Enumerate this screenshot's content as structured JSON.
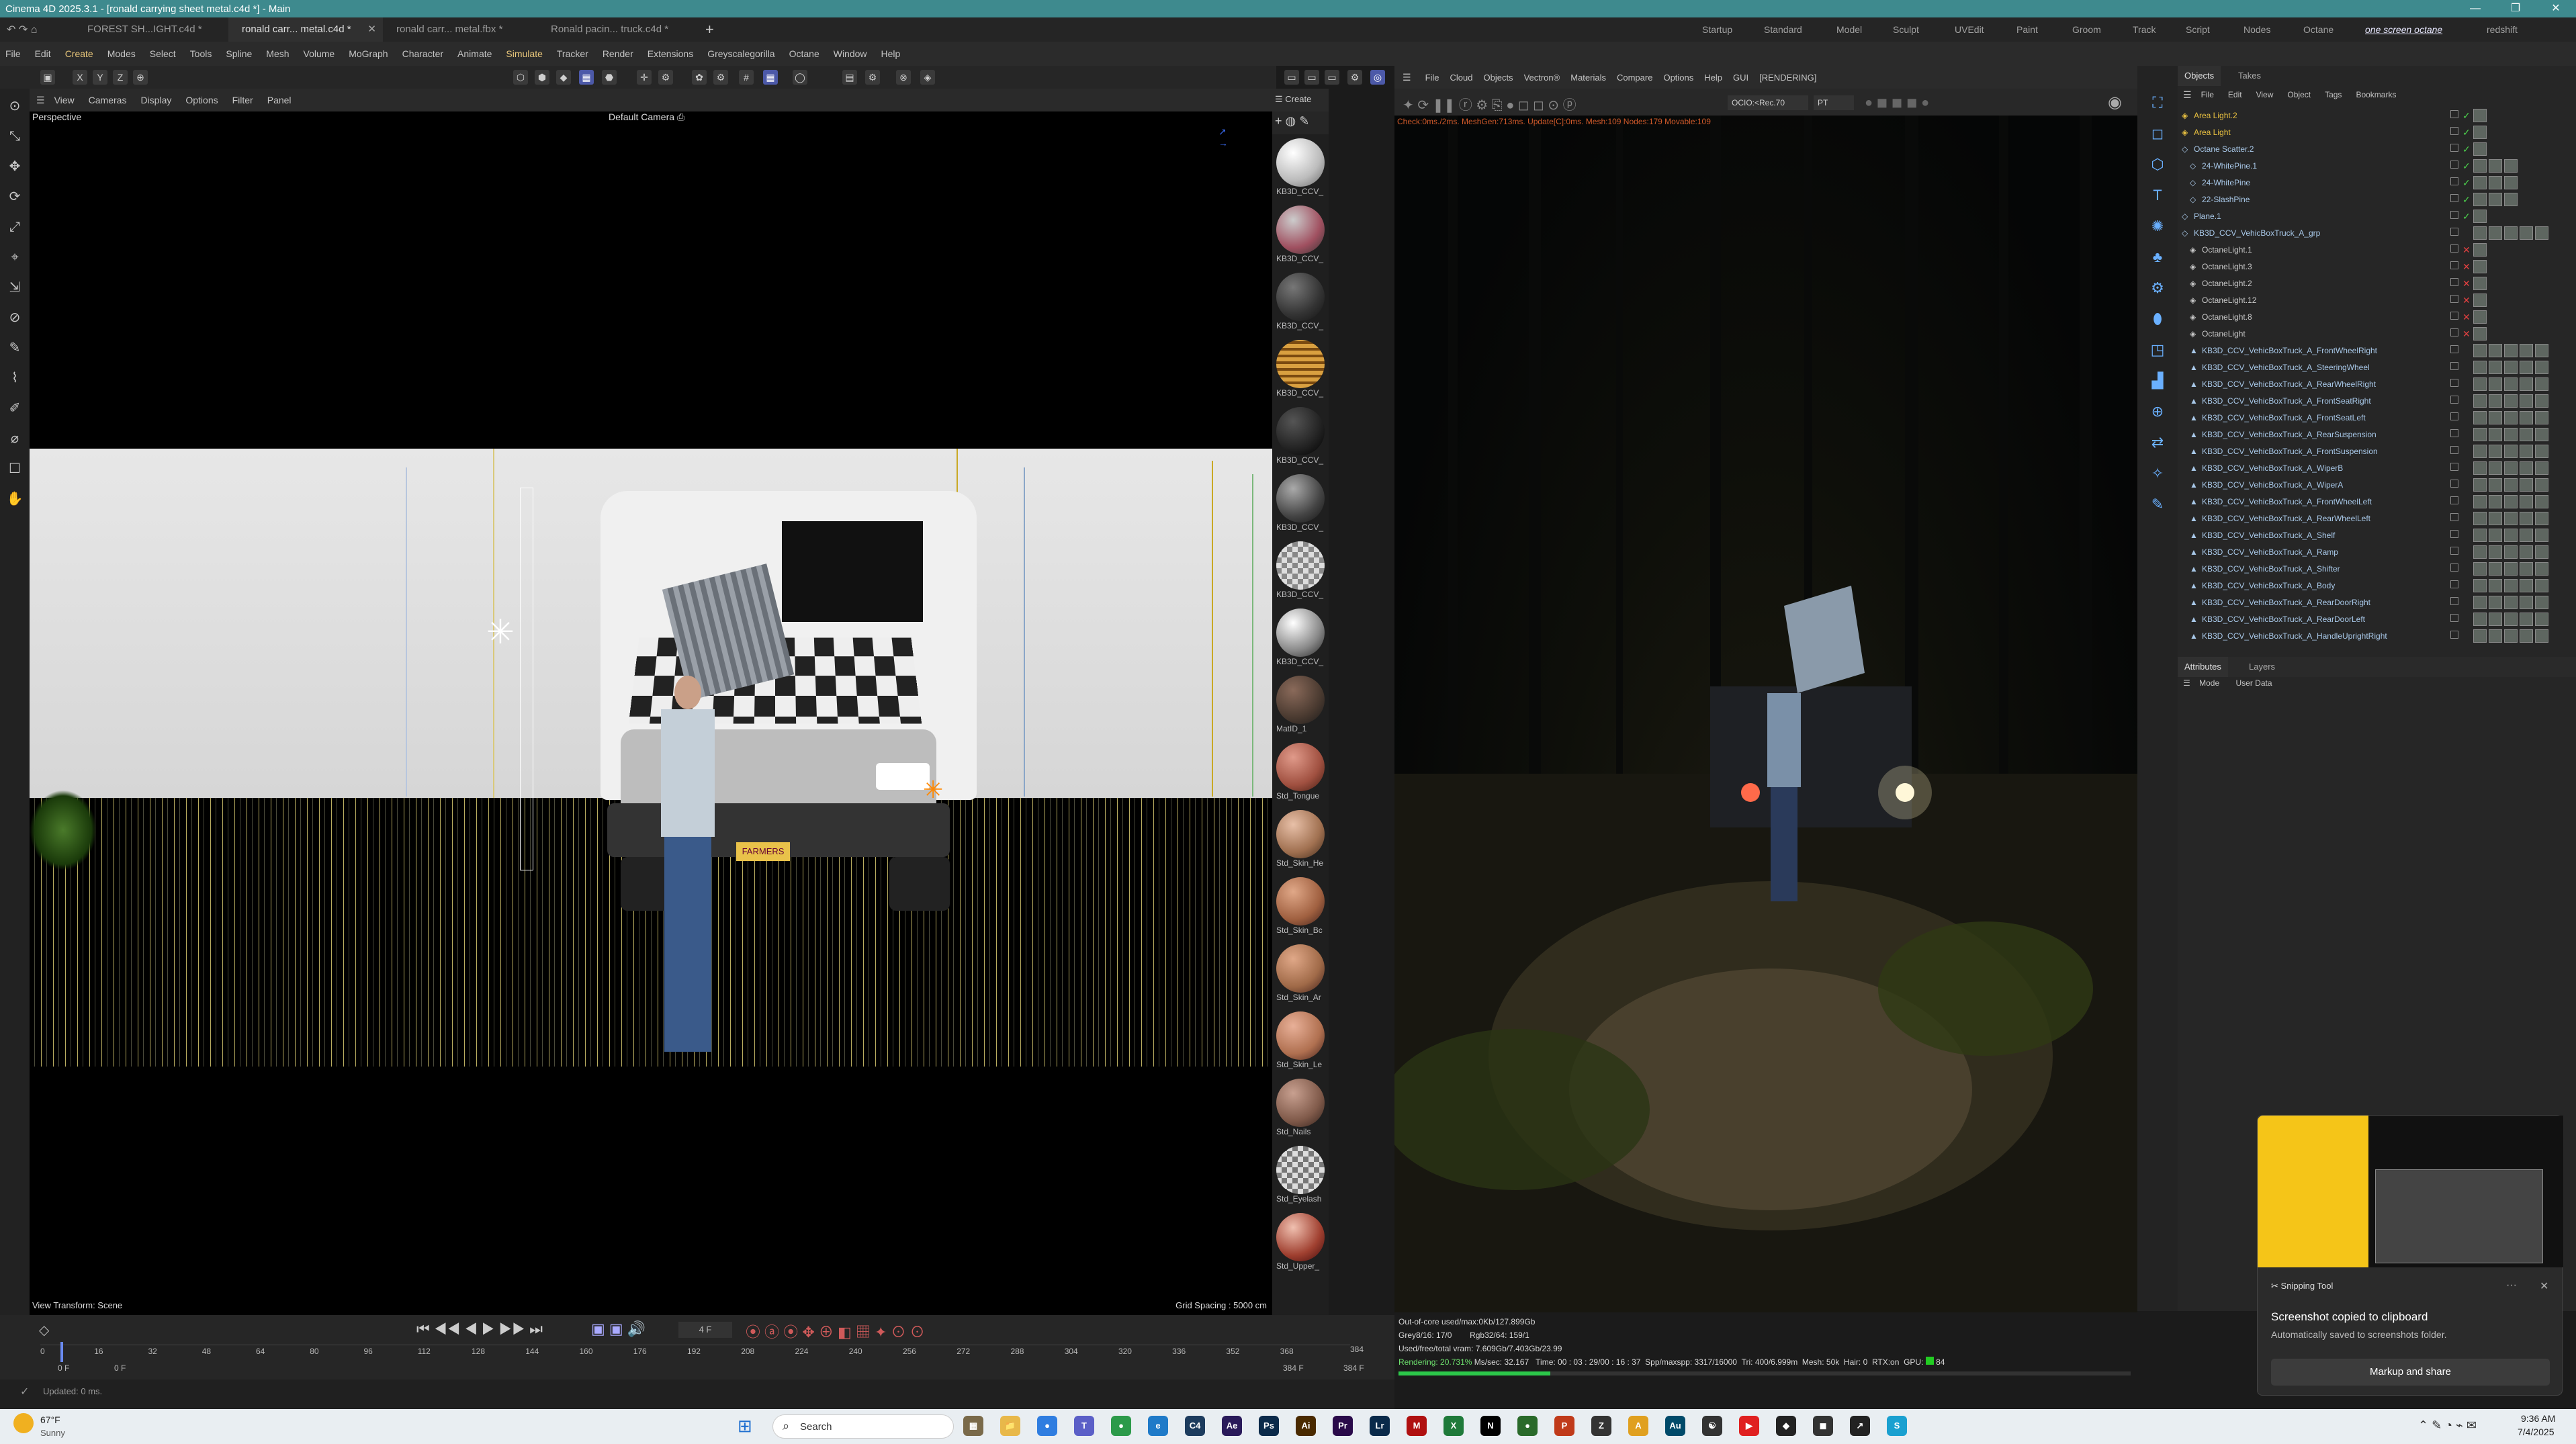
{
  "app_title": "Cinema 4D 2025.3.1 - [ronald carrying sheet metal.c4d *] - Main",
  "window_controls": [
    "—",
    "❐",
    "✕"
  ],
  "file_tabs": [
    {
      "label": "FOREST SH...IGHT.c4d *",
      "active": false
    },
    {
      "label": "ronald carr... metal.c4d *",
      "active": true
    },
    {
      "label": "ronald carr... metal.fbx *",
      "active": false
    },
    {
      "label": "Ronald pacin... truck.c4d *",
      "active": false
    }
  ],
  "add_tab": "+",
  "layouts": [
    "Startup",
    "Standard",
    "Model",
    "Sculpt",
    "UVEdit",
    "Paint",
    "Groom",
    "Track",
    "Script",
    "Nodes",
    "Octane",
    "one screen octane",
    "redshift"
  ],
  "active_layout": "one screen octane",
  "menu": [
    "File",
    "Edit",
    "Create",
    "Modes",
    "Select",
    "Tools",
    "Spline",
    "Mesh",
    "Volume",
    "MoGraph",
    "Character",
    "Animate",
    "Simulate",
    "Tracker",
    "Render",
    "Extensions",
    "Greyscalegorilla",
    "Octane",
    "Window",
    "Help"
  ],
  "active_menu": [
    "Create",
    "Simulate"
  ],
  "viewport": {
    "menu": [
      "View",
      "Cameras",
      "Display",
      "Options",
      "Filter",
      "Panel"
    ],
    "name": "Perspective",
    "camera": "Default Camera",
    "view_transform": "View Transform: Scene",
    "grid_spacing": "Grid Spacing : 5000 cm",
    "plate_text": "FARMERS"
  },
  "materials": {
    "create_label": "Create",
    "items": [
      "KB3D_CCV_",
      "KB3D_CCV_",
      "KB3D_CCV_",
      "KB3D_CCV_",
      "KB3D_CCV_",
      "KB3D_CCV_",
      "KB3D_CCV_",
      "KB3D_CCV_",
      "MatID_1",
      "Std_Tongue",
      "Std_Skin_He",
      "Std_Skin_Bc",
      "Std_Skin_Ar",
      "Std_Skin_Le",
      "Std_Nails",
      "Std_Eyelash",
      "Std_Upper_"
    ]
  },
  "render_view": {
    "menu": [
      "File",
      "Cloud",
      "Objects",
      "Vectron®",
      "Materials",
      "Compare",
      "Options",
      "Help",
      "GUI",
      "[RENDERING]"
    ],
    "ocio": "OCIO:<Rec.70",
    "pt": "PT",
    "top_stats": "Check:0ms./2ms. MeshGen:713ms. Update[C]:0ms. Mesh:109 Nodes:179 Movable:109",
    "stats": {
      "out_of_core": "Out-of-core used/max:0Kb/127.899Gb",
      "grey": "Grey8/16: 17/0",
      "rgb": "Rgb32/64: 159/1",
      "vram": "Used/free/total vram: 7.609Gb/7.403Gb/23.99",
      "rendering": "Rendering: 20.731%",
      "ms_sec": "Ms/sec: 32.167",
      "time": "Time: 00 : 03 : 29/00 : 16 : 37",
      "spp": "Spp/maxspp: 3317/16000",
      "tri": "Tri: 400/6.999m",
      "mesh": "Mesh: 50k",
      "hair": "Hair: 0",
      "rtx": "RTX:on",
      "gpu": "GPU:",
      "gpu_val": "84"
    }
  },
  "objects_panel": {
    "tabs": [
      "Objects",
      "Takes"
    ],
    "menu": [
      "File",
      "Edit",
      "View",
      "Object",
      "Tags",
      "Bookmarks"
    ],
    "rows": [
      {
        "name": "Area Light.2",
        "color": "#e8c040",
        "indent": 0,
        "flag": "✓"
      },
      {
        "name": "Area Light",
        "color": "#e8c040",
        "indent": 0,
        "flag": "✓"
      },
      {
        "name": "Octane Scatter.2",
        "color": "#a8c8e8",
        "indent": 0,
        "flag": "✓"
      },
      {
        "name": "24-WhitePine.1",
        "color": "#a8c8e8",
        "indent": 1,
        "flag": "✓"
      },
      {
        "name": "24-WhitePine",
        "color": "#a8c8e8",
        "indent": 1,
        "flag": "✓"
      },
      {
        "name": "22-SlashPine",
        "color": "#a8c8e8",
        "indent": 1,
        "flag": "✓"
      },
      {
        "name": "Plane.1",
        "color": "#a8c8e8",
        "indent": 0,
        "flag": "✓"
      },
      {
        "name": "KB3D_CCV_VehicBoxTruck_A_grp",
        "color": "#a8c8e8",
        "indent": 0,
        "flag": ""
      },
      {
        "name": "OctaneLight.1",
        "color": "#c8c8c8",
        "indent": 1,
        "flag": "✕"
      },
      {
        "name": "OctaneLight.3",
        "color": "#c8c8c8",
        "indent": 1,
        "flag": "✕"
      },
      {
        "name": "OctaneLight.2",
        "color": "#c8c8c8",
        "indent": 1,
        "flag": "✕"
      },
      {
        "name": "OctaneLight.12",
        "color": "#c8c8c8",
        "indent": 1,
        "flag": "✕"
      },
      {
        "name": "OctaneLight.8",
        "color": "#c8c8c8",
        "indent": 1,
        "flag": "✕"
      },
      {
        "name": "OctaneLight",
        "color": "#c8c8c8",
        "indent": 1,
        "flag": "✕"
      },
      {
        "name": "KB3D_CCV_VehicBoxTruck_A_FrontWheelRight",
        "color": "#a8c8e8",
        "indent": 1,
        "flag": ""
      },
      {
        "name": "KB3D_CCV_VehicBoxTruck_A_SteeringWheel",
        "color": "#a8c8e8",
        "indent": 1,
        "flag": ""
      },
      {
        "name": "KB3D_CCV_VehicBoxTruck_A_RearWheelRight",
        "color": "#a8c8e8",
        "indent": 1,
        "flag": ""
      },
      {
        "name": "KB3D_CCV_VehicBoxTruck_A_FrontSeatRight",
        "color": "#a8c8e8",
        "indent": 1,
        "flag": ""
      },
      {
        "name": "KB3D_CCV_VehicBoxTruck_A_FrontSeatLeft",
        "color": "#a8c8e8",
        "indent": 1,
        "flag": ""
      },
      {
        "name": "KB3D_CCV_VehicBoxTruck_A_RearSuspension",
        "color": "#a8c8e8",
        "indent": 1,
        "flag": ""
      },
      {
        "name": "KB3D_CCV_VehicBoxTruck_A_FrontSuspension",
        "color": "#a8c8e8",
        "indent": 1,
        "flag": ""
      },
      {
        "name": "KB3D_CCV_VehicBoxTruck_A_WiperB",
        "color": "#a8c8e8",
        "indent": 1,
        "flag": ""
      },
      {
        "name": "KB3D_CCV_VehicBoxTruck_A_WiperA",
        "color": "#a8c8e8",
        "indent": 1,
        "flag": ""
      },
      {
        "name": "KB3D_CCV_VehicBoxTruck_A_FrontWheelLeft",
        "color": "#a8c8e8",
        "indent": 1,
        "flag": ""
      },
      {
        "name": "KB3D_CCV_VehicBoxTruck_A_RearWheelLeft",
        "color": "#a8c8e8",
        "indent": 1,
        "flag": ""
      },
      {
        "name": "KB3D_CCV_VehicBoxTruck_A_Shelf",
        "color": "#a8c8e8",
        "indent": 1,
        "flag": ""
      },
      {
        "name": "KB3D_CCV_VehicBoxTruck_A_Ramp",
        "color": "#a8c8e8",
        "indent": 1,
        "flag": ""
      },
      {
        "name": "KB3D_CCV_VehicBoxTruck_A_Shifter",
        "color": "#a8c8e8",
        "indent": 1,
        "flag": ""
      },
      {
        "name": "KB3D_CCV_VehicBoxTruck_A_Body",
        "color": "#a8c8e8",
        "indent": 1,
        "flag": ""
      },
      {
        "name": "KB3D_CCV_VehicBoxTruck_A_RearDoorRight",
        "color": "#a8c8e8",
        "indent": 1,
        "flag": ""
      },
      {
        "name": "KB3D_CCV_VehicBoxTruck_A_RearDoorLeft",
        "color": "#a8c8e8",
        "indent": 1,
        "flag": ""
      },
      {
        "name": "KB3D_CCV_VehicBoxTruck_A_HandleUprightRight",
        "color": "#a8c8e8",
        "indent": 1,
        "flag": ""
      }
    ]
  },
  "attributes_panel": {
    "tabs": [
      "Attributes",
      "Layers"
    ],
    "menu": [
      "Mode",
      "User Data"
    ]
  },
  "timeline": {
    "current_frame": "4 F",
    "ticks": [
      "0",
      "16",
      "32",
      "48",
      "64",
      "80",
      "96",
      "112",
      "128",
      "144",
      "160",
      "176",
      "192",
      "208",
      "224",
      "240",
      "256",
      "272",
      "288",
      "304",
      "320",
      "336",
      "352",
      "368"
    ],
    "start_a": "0 F",
    "start_b": "0 F",
    "end_a": "384 F",
    "end_b": "384 F",
    "end_tick": "384"
  },
  "status": {
    "text": "Updated: 0 ms."
  },
  "taskbar": {
    "weather_temp": "67°F",
    "weather_desc": "Sunny",
    "search": "Search",
    "time": "9:36 AM",
    "date": "7/4/2025",
    "apps": [
      {
        "label": "▦",
        "color": "#7a6a4a"
      },
      {
        "label": "📁",
        "color": "#e8b84a"
      },
      {
        "label": "●",
        "color": "#2f7de0"
      },
      {
        "label": "T",
        "color": "#5b5fc7"
      },
      {
        "label": "●",
        "color": "#2c9a4a"
      },
      {
        "label": "e",
        "color": "#1f7ac8"
      },
      {
        "label": "C4",
        "color": "#1d3c5e"
      },
      {
        "label": "Ae",
        "color": "#2a1a5a"
      },
      {
        "label": "Ps",
        "color": "#0b2a4a"
      },
      {
        "label": "Ai",
        "color": "#4a2a00"
      },
      {
        "label": "Pr",
        "color": "#2a0a4a"
      },
      {
        "label": "Lr",
        "color": "#0a2a4a"
      },
      {
        "label": "M",
        "color": "#b01010"
      },
      {
        "label": "X",
        "color": "#1f7a3a"
      },
      {
        "label": "N",
        "color": "#000"
      },
      {
        "label": "●",
        "color": "#2a6a2a"
      },
      {
        "label": "P",
        "color": "#c03a1a"
      },
      {
        "label": "Z",
        "color": "#333"
      },
      {
        "label": "A",
        "color": "#e0a020"
      },
      {
        "label": "Au",
        "color": "#004a6a"
      },
      {
        "label": "☯",
        "color": "#333"
      },
      {
        "label": "▶",
        "color": "#e02020"
      },
      {
        "label": "◆",
        "color": "#222"
      },
      {
        "label": "◼",
        "color": "#333"
      },
      {
        "label": "↗",
        "color": "#222"
      },
      {
        "label": "S",
        "color": "#1aa0d0"
      }
    ]
  },
  "snipping_tool": {
    "app": "Snipping Tool",
    "title": "Screenshot copied to clipboard",
    "subtitle": "Automatically saved to screenshots folder.",
    "button": "Markup and share",
    "more": "···",
    "close": "✕"
  }
}
